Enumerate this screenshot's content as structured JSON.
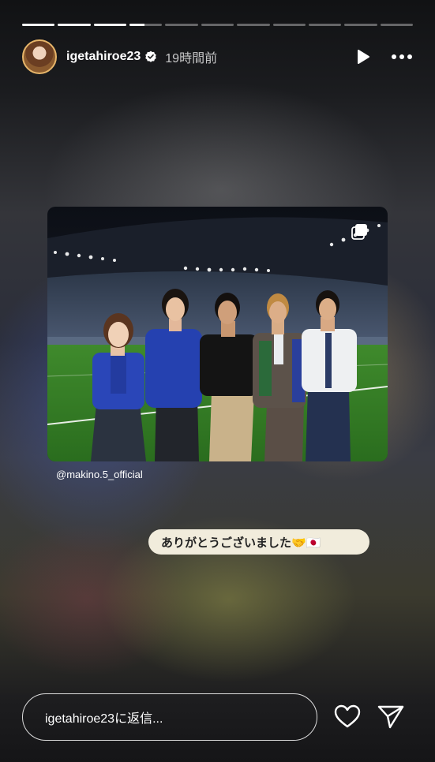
{
  "progress": {
    "segments": 11,
    "current": 3,
    "current_fill": 0.45
  },
  "header": {
    "username": "igetahiroe23",
    "time": "19時間前",
    "verified": true
  },
  "icons": {
    "verified": "verified-badge-icon",
    "play": "play-icon",
    "more": "more-options-icon",
    "heart": "heart-icon",
    "send": "send-icon"
  },
  "story": {
    "mention": "@makino.5_official",
    "sticker_text": "ありがとうございました🤝🇯🇵"
  },
  "reply": {
    "placeholder": "igetahiroe23に返信..."
  },
  "colors": {
    "accent_ring": "#e6b56a",
    "sticker_bg": "#f1ecdc"
  }
}
